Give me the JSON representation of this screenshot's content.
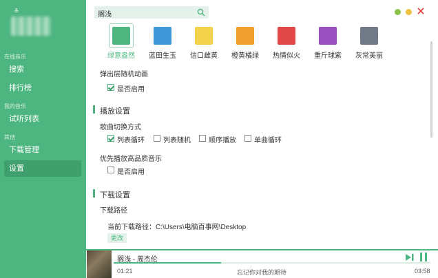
{
  "colors": {
    "accent": "#4db57f",
    "sidebar_bg": "#4db57f",
    "sidebar_active": "#3fa06d"
  },
  "sidebar": {
    "logo_glyph": "≚",
    "sections": [
      {
        "title": "在线音乐",
        "items": [
          {
            "label": "搜索"
          },
          {
            "label": "排行榜"
          }
        ]
      },
      {
        "title": "我的音乐",
        "items": [
          {
            "label": "试听列表"
          }
        ]
      },
      {
        "title": "其他",
        "items": [
          {
            "label": "下载管理"
          },
          {
            "label": "设置",
            "active": true
          }
        ]
      }
    ]
  },
  "search": {
    "value": "搁浅"
  },
  "window_controls": {
    "minimize_color": "#8bc34a",
    "maximize_color": "#f0c040",
    "close_color": "#f44336"
  },
  "themes": [
    {
      "label": "绿意盎然",
      "color": "#4db57f",
      "selected": true
    },
    {
      "label": "蓝田生玉",
      "color": "#3f97d8"
    },
    {
      "label": "信口雌黄",
      "color": "#f2d24b"
    },
    {
      "label": "橙黄橘绿",
      "color": "#f0a030"
    },
    {
      "label": "热情似火",
      "color": "#e04848"
    },
    {
      "label": "重斤球紫",
      "color": "#9a4fc0"
    },
    {
      "label": "灰常美丽",
      "color": "#6f7a86"
    }
  ],
  "settings": {
    "popup_anim": {
      "title": "弹出层随机动画",
      "option": "是否启用",
      "checked": true
    },
    "playback": {
      "section": "播放设置",
      "switch_mode": {
        "title": "歌曲切换方式",
        "options": [
          {
            "label": "列表循环",
            "checked": true
          },
          {
            "label": "列表随机",
            "checked": false
          },
          {
            "label": "顺序播放",
            "checked": false
          },
          {
            "label": "单曲循环",
            "checked": false
          }
        ]
      },
      "hq": {
        "title": "优先播放高品质音乐",
        "option": "是否启用",
        "checked": false
      }
    },
    "download": {
      "section": "下载设置",
      "path_title": "下载路径",
      "current_label": "当前下载路径：",
      "current_path": "C:\\Users\\电脑百事网\\Desktop",
      "change_button": "更改"
    }
  },
  "player": {
    "song": "搁浅 - 周杰伦",
    "elapsed": "01:21",
    "duration": "03:58",
    "lyric": "忘记你对我的期待",
    "progress": 0.34
  }
}
